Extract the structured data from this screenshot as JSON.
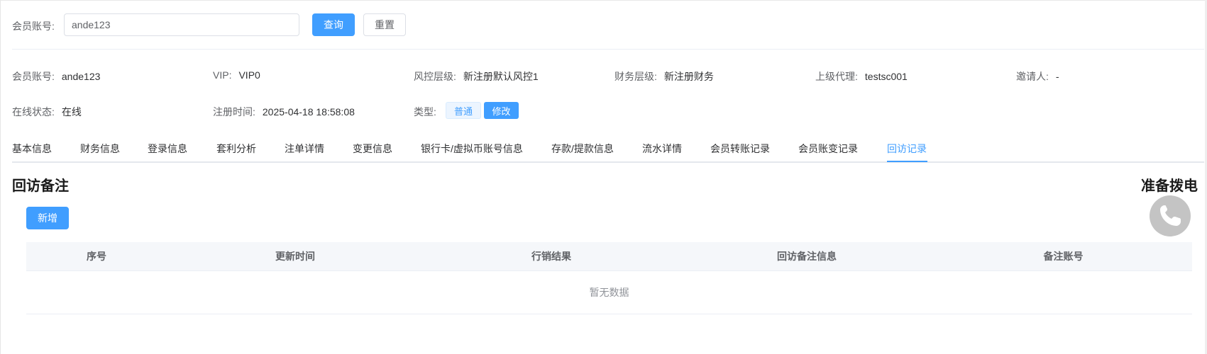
{
  "search": {
    "label": "会员账号:",
    "value": "ande123",
    "query_button": "查询",
    "reset_button": "重置"
  },
  "info": {
    "account": {
      "label": "会员账号:",
      "value": "ande123"
    },
    "vip": {
      "label": "VIP:",
      "value": "VIP0"
    },
    "risk_level": {
      "label": "风控层级:",
      "value": "新注册默认风控1"
    },
    "finance_level": {
      "label": "财务层级:",
      "value": "新注册财务"
    },
    "parent_agent": {
      "label": "上级代理:",
      "value": "testsc001"
    },
    "inviter": {
      "label": "邀请人:",
      "value": "-"
    },
    "online_status": {
      "label": "在线状态:",
      "value": "在线"
    },
    "register_time": {
      "label": "注册时间:",
      "value": "2025-04-18 18:58:08"
    },
    "type": {
      "label": "类型:",
      "tag": "普通",
      "edit_button": "修改"
    }
  },
  "tabs": [
    "基本信息",
    "财务信息",
    "登录信息",
    "套利分析",
    "注单详情",
    "变更信息",
    "银行卡/虚拟币账号信息",
    "存款/提款信息",
    "流水详情",
    "会员转账记录",
    "会员账变记录",
    "回访记录"
  ],
  "active_tab": "回访记录",
  "section": {
    "title": "回访备注",
    "dial_title": "准备拨电",
    "add_button": "新增"
  },
  "table": {
    "columns": [
      "序号",
      "更新时间",
      "行销结果",
      "回访备注信息",
      "备注账号"
    ],
    "empty_text": "暂无数据"
  },
  "colors": {
    "primary": "#409eff",
    "border": "#dcdfe6",
    "header_bg": "#f5f7fa"
  }
}
